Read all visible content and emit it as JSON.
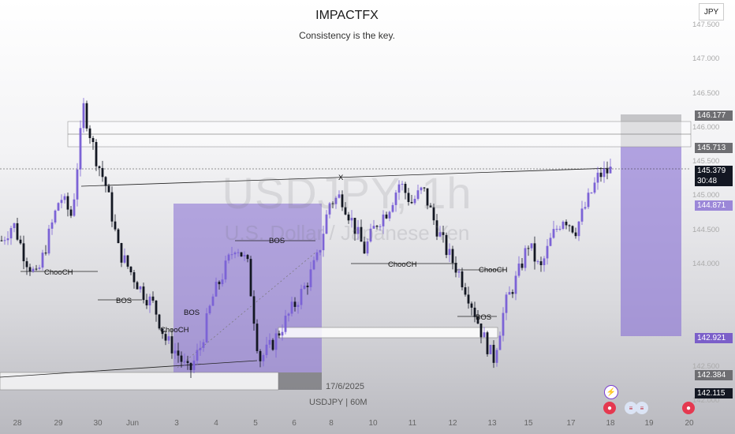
{
  "header": {
    "title": "IMPACTFX",
    "subtitle": "Consistency is the key.",
    "currency": "JPY"
  },
  "watermark": {
    "symbol": "USDJPY, 1h",
    "description": "U.S. Dollar / Japanese Yen"
  },
  "footer": {
    "date": "17/6/2025",
    "symbol_line": "USDJPY | 60M"
  },
  "chart_data": {
    "type": "candlestick",
    "symbol": "USDJPY",
    "timeframe": "60M",
    "ylim": [
      141.9,
      147.6
    ],
    "y_ticks": [
      "147.500",
      "147.000",
      "146.500",
      "146.000",
      "145.500",
      "145.000",
      "144.500",
      "144.000",
      "142.500",
      "142.000"
    ],
    "x_ticks": [
      "28",
      "29",
      "30",
      "Jun",
      "3",
      "4",
      "5",
      "6",
      "8",
      "10",
      "11",
      "12",
      "13",
      "15",
      "17",
      "18",
      "19",
      "20"
    ],
    "price_tags": [
      {
        "value": "146.177",
        "color": "#6e6e72"
      },
      {
        "value": "145.713",
        "color": "#6e6e72"
      },
      {
        "value": "145.379",
        "color": "#131722",
        "countdown": "30:48"
      },
      {
        "value": "144.871",
        "color": "#9b87d8"
      },
      {
        "value": "142.921",
        "color": "#7b5fc9"
      },
      {
        "value": "142.384",
        "color": "#6e6e72"
      },
      {
        "value": "142.115",
        "color": "#131722"
      }
    ],
    "annotations": [
      "ChooCH",
      "BOS",
      "ChooCH",
      "BOS",
      "BOS",
      "X",
      "ChooCH",
      "ChooCH",
      "BOS"
    ],
    "ohlc_path_closes": [
      144.35,
      144.6,
      144.1,
      143.8,
      144.4,
      145.0,
      144.7,
      146.3,
      145.6,
      145.1,
      144.2,
      143.9,
      143.6,
      143.4,
      142.9,
      142.7,
      142.4,
      142.8,
      143.5,
      143.9,
      144.3,
      144.0,
      142.6,
      142.8,
      143.1,
      143.4,
      143.7,
      144.1,
      144.9,
      145.0,
      144.6,
      144.2,
      144.6,
      144.8,
      145.2,
      144.9,
      145.1,
      144.6,
      144.2,
      143.9,
      143.5,
      143.0,
      142.6,
      143.4,
      143.8,
      144.3,
      143.9,
      144.4,
      144.7,
      144.5,
      144.9,
      145.3,
      145.379
    ],
    "colors": {
      "up": "#7c63d6",
      "down": "#131722",
      "zone": "#8c74d4"
    }
  }
}
